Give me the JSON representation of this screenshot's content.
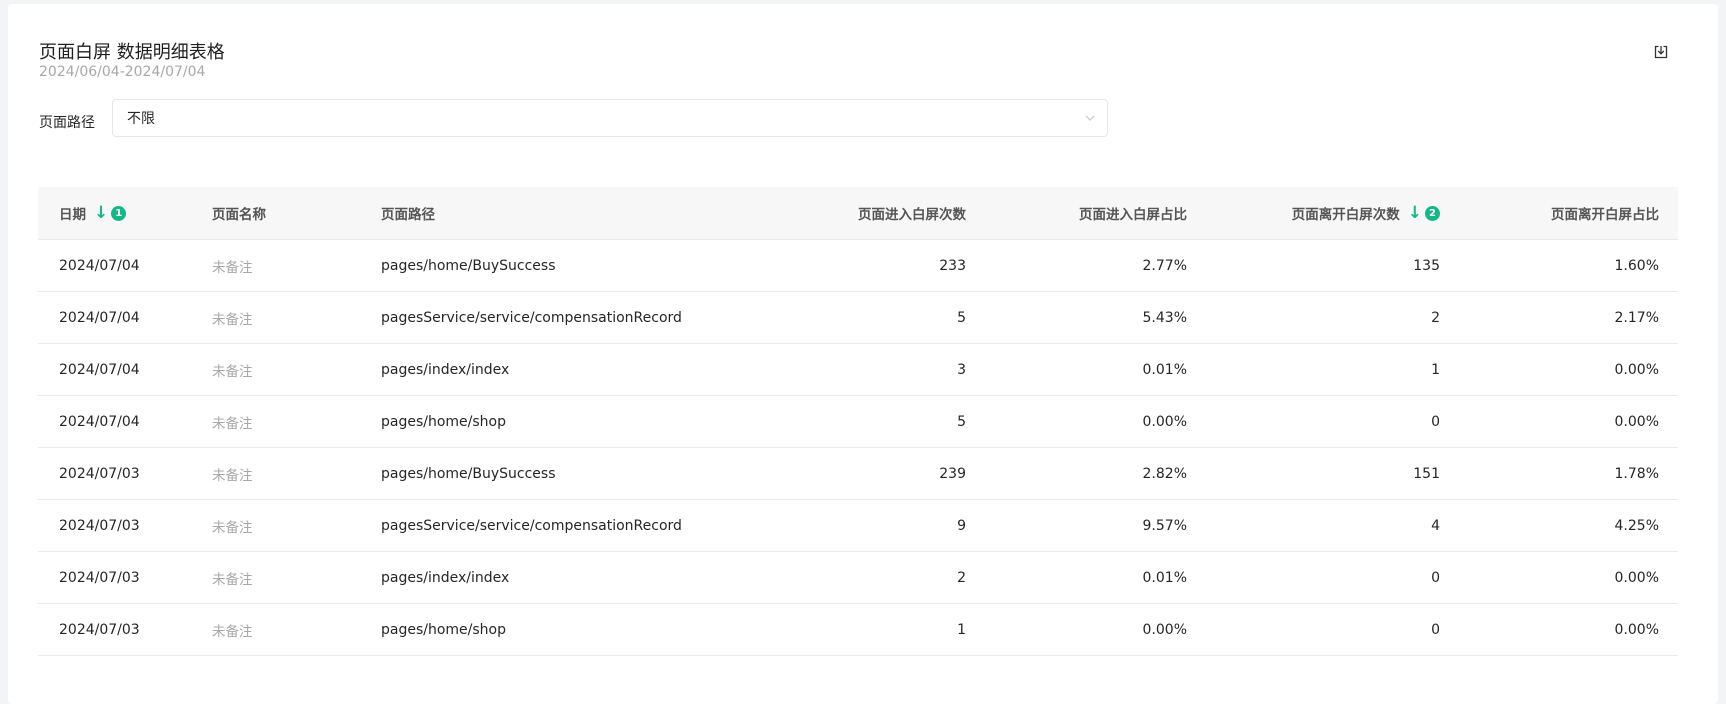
{
  "header": {
    "title": "页面白屏 数据明细表格",
    "date_range": "2024/06/04-2024/07/04"
  },
  "filter": {
    "label": "页面路径",
    "value": "不限"
  },
  "table": {
    "columns": {
      "date": "日期",
      "date_sort_rank": "1",
      "page_name": "页面名称",
      "page_path": "页面路径",
      "enter_count": "页面进入白屏次数",
      "enter_ratio": "页面进入白屏占比",
      "leave_count": "页面离开白屏次数",
      "leave_sort_rank": "2",
      "leave_ratio": "页面离开白屏占比"
    },
    "rows": [
      {
        "date": "2024/07/04",
        "name": "未备注",
        "path": "pages/home/BuySuccess",
        "enter_count": "233",
        "enter_ratio": "2.77%",
        "leave_count": "135",
        "leave_ratio": "1.60%"
      },
      {
        "date": "2024/07/04",
        "name": "未备注",
        "path": "pagesService/service/compensationRecord",
        "enter_count": "5",
        "enter_ratio": "5.43%",
        "leave_count": "2",
        "leave_ratio": "2.17%"
      },
      {
        "date": "2024/07/04",
        "name": "未备注",
        "path": "pages/index/index",
        "enter_count": "3",
        "enter_ratio": "0.01%",
        "leave_count": "1",
        "leave_ratio": "0.00%"
      },
      {
        "date": "2024/07/04",
        "name": "未备注",
        "path": "pages/home/shop",
        "enter_count": "5",
        "enter_ratio": "0.00%",
        "leave_count": "0",
        "leave_ratio": "0.00%"
      },
      {
        "date": "2024/07/03",
        "name": "未备注",
        "path": "pages/home/BuySuccess",
        "enter_count": "239",
        "enter_ratio": "2.82%",
        "leave_count": "151",
        "leave_ratio": "1.78%"
      },
      {
        "date": "2024/07/03",
        "name": "未备注",
        "path": "pagesService/service/compensationRecord",
        "enter_count": "9",
        "enter_ratio": "9.57%",
        "leave_count": "4",
        "leave_ratio": "4.25%"
      },
      {
        "date": "2024/07/03",
        "name": "未备注",
        "path": "pages/index/index",
        "enter_count": "2",
        "enter_ratio": "0.01%",
        "leave_count": "0",
        "leave_ratio": "0.00%"
      },
      {
        "date": "2024/07/03",
        "name": "未备注",
        "path": "pages/home/shop",
        "enter_count": "1",
        "enter_ratio": "0.00%",
        "leave_count": "0",
        "leave_ratio": "0.00%"
      }
    ]
  },
  "icons": {
    "export": "download-icon",
    "select_arrow": "chevron-down-icon",
    "sort": "arrow-down-icon"
  },
  "colors": {
    "accent": "#12b886"
  }
}
